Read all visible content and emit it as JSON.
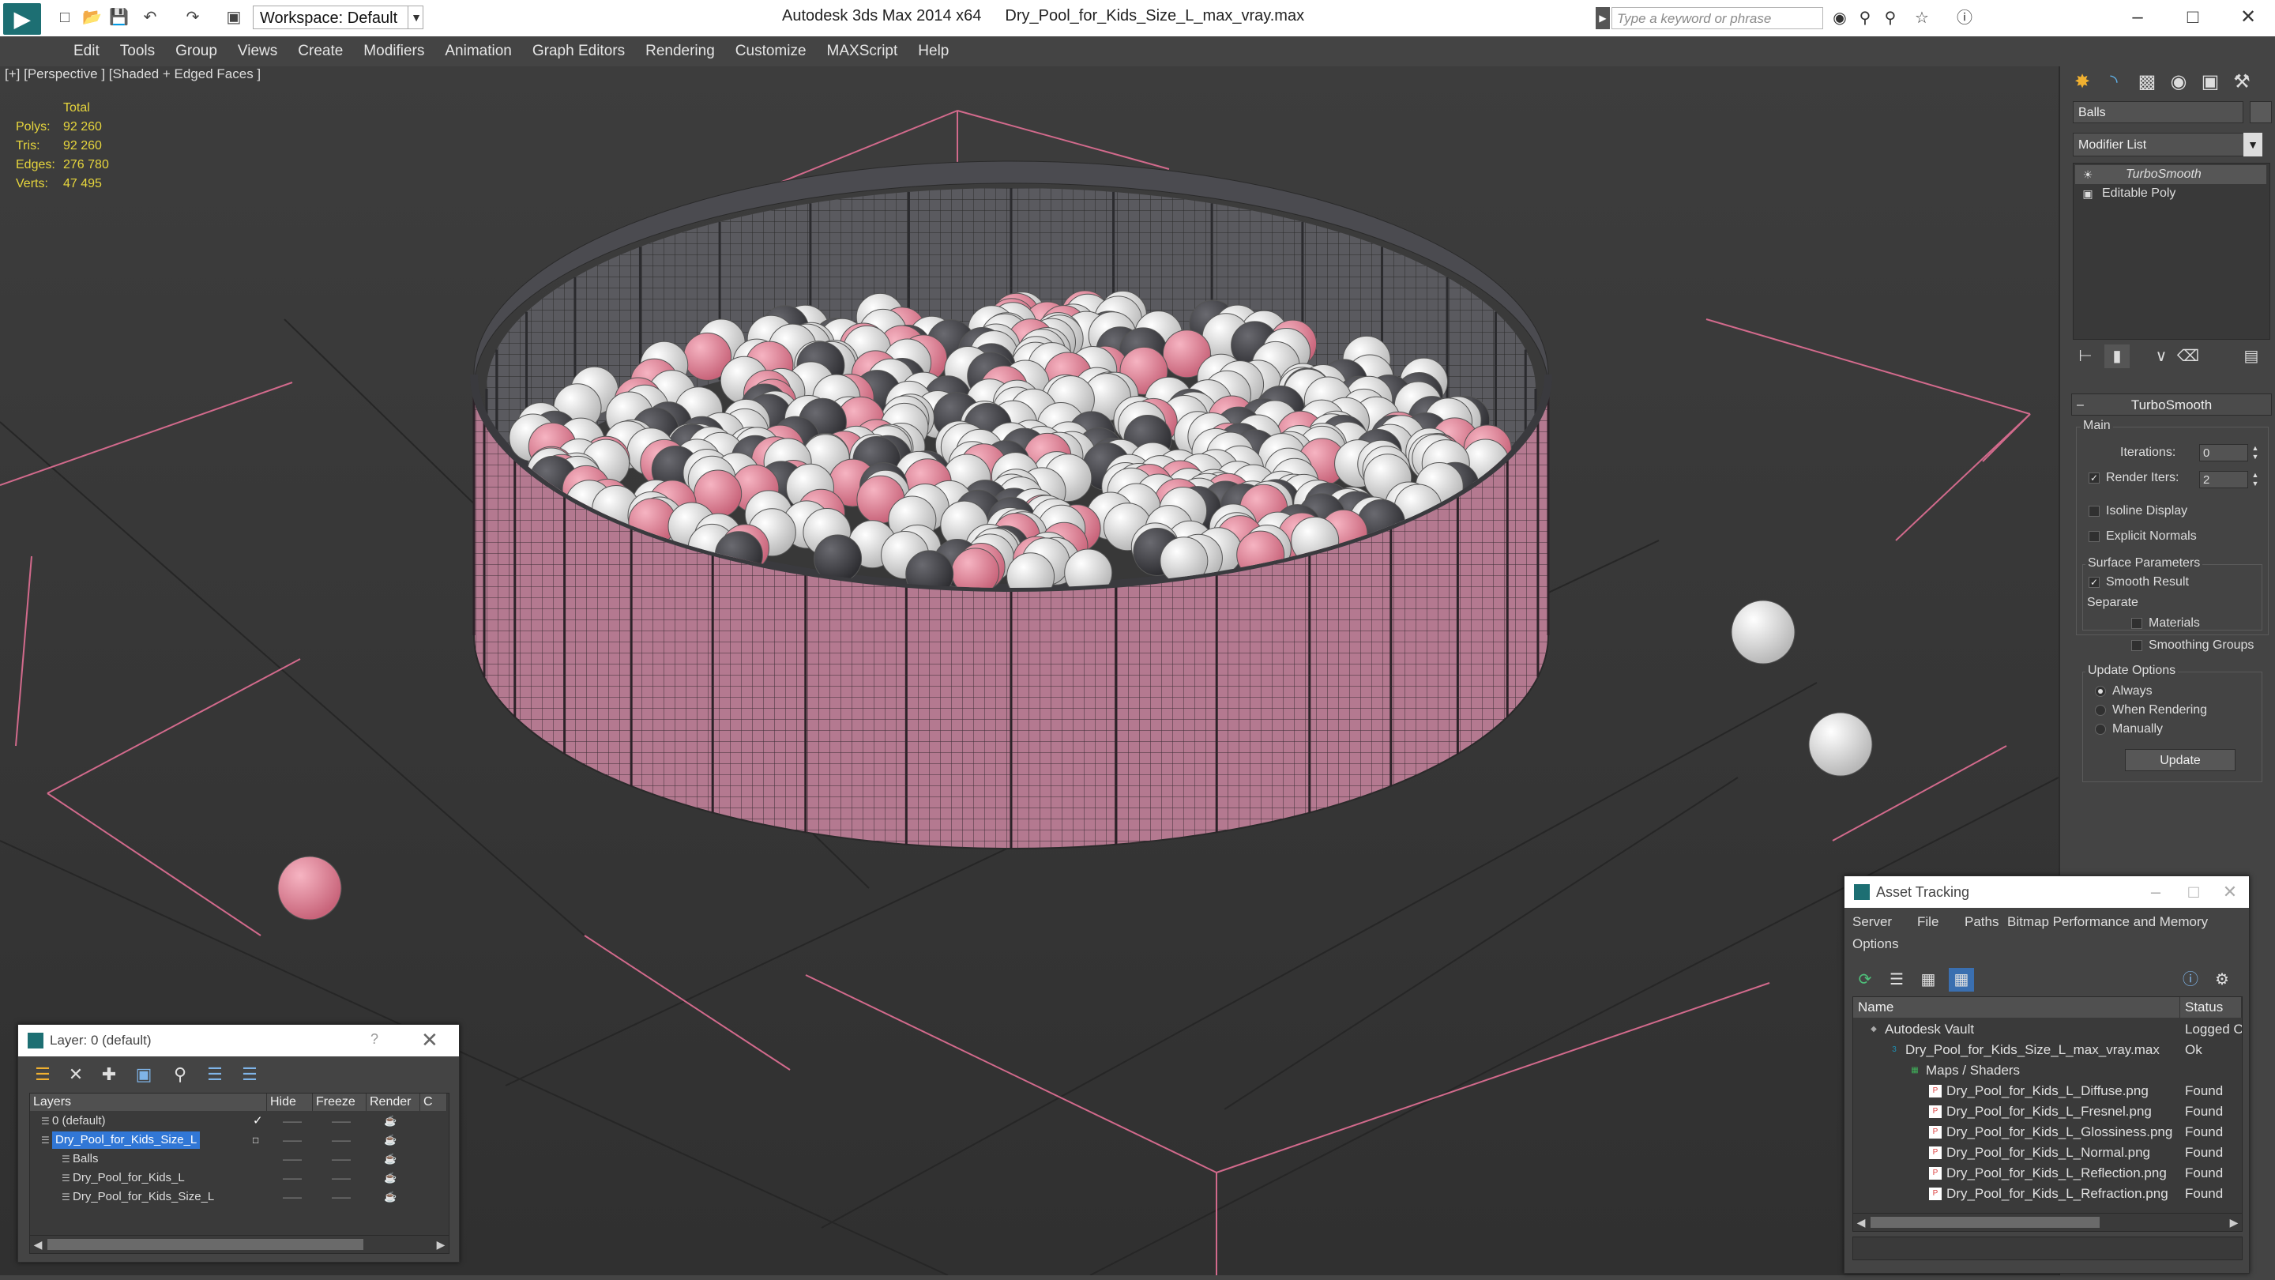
{
  "titlebar": {
    "workspace": "Workspace: Default",
    "app_name": "Autodesk 3ds Max  2014 x64",
    "file_name": "Dry_Pool_for_Kids_Size_L_max_vray.max",
    "search_placeholder": "Type a keyword or phrase"
  },
  "menu": [
    "Edit",
    "Tools",
    "Group",
    "Views",
    "Create",
    "Modifiers",
    "Animation",
    "Graph Editors",
    "Rendering",
    "Customize",
    "MAXScript",
    "Help"
  ],
  "viewport": {
    "label": "[+] [Perspective ] [Shaded + Edged Faces ]",
    "stats": {
      "header": "Total",
      "rows": [
        {
          "label": "Polys:",
          "value": "92 260"
        },
        {
          "label": "Tris:",
          "value": "92 260"
        },
        {
          "label": "Edges:",
          "value": "276 780"
        },
        {
          "label": "Verts:",
          "value": "47 495"
        }
      ]
    }
  },
  "command_panel": {
    "object_name": "Balls",
    "modifier_list": "Modifier List",
    "stack": [
      "TurboSmooth",
      "Editable Poly"
    ],
    "rollout_title": "TurboSmooth",
    "main_label": "Main",
    "iterations_label": "Iterations:",
    "iterations_value": "0",
    "render_iters_label": "Render Iters:",
    "render_iters_value": "2",
    "render_iters_checked": true,
    "isoline_label": "Isoline Display",
    "explicit_normals_label": "Explicit Normals",
    "surface_params_label": "Surface Parameters",
    "smooth_result_label": "Smooth Result",
    "smooth_result_checked": true,
    "separate_label": "Separate",
    "materials_label": "Materials",
    "smoothing_groups_label": "Smoothing Groups",
    "update_options_label": "Update Options",
    "radio_options": [
      "Always",
      "When Rendering",
      "Manually"
    ],
    "radio_selected": "Always",
    "update_button": "Update"
  },
  "layer_dialog": {
    "title": "Layer: 0 (default)",
    "help": "?",
    "columns": [
      "Layers",
      "Hide",
      "Freeze",
      "Render",
      "C"
    ],
    "rows": [
      {
        "name": "0 (default)",
        "indent": 1,
        "selected": false,
        "current": true
      },
      {
        "name": "Dry_Pool_for_Kids_Size_L",
        "indent": 1,
        "selected": true,
        "current": false
      },
      {
        "name": "Balls",
        "indent": 2,
        "selected": false,
        "current": false
      },
      {
        "name": "Dry_Pool_for_Kids_L",
        "indent": 2,
        "selected": false,
        "current": false
      },
      {
        "name": "Dry_Pool_for_Kids_Size_L",
        "indent": 2,
        "selected": false,
        "current": false
      }
    ]
  },
  "asset_dialog": {
    "title": "Asset Tracking",
    "menu": [
      "Server",
      "File",
      "Paths",
      "Bitmap Performance and Memory",
      "Options"
    ],
    "columns": [
      "Name",
      "Status"
    ],
    "rows": [
      {
        "name": "Autodesk Vault",
        "status": "Logged O",
        "level": 0,
        "icon": "vault"
      },
      {
        "name": "Dry_Pool_for_Kids_Size_L_max_vray.max",
        "status": "Ok",
        "level": 1,
        "icon": "max"
      },
      {
        "name": "Maps / Shaders",
        "status": "",
        "level": 2,
        "icon": "folder"
      },
      {
        "name": "Dry_Pool_for_Kids_L_Diffuse.png",
        "status": "Found",
        "level": 3,
        "icon": "png"
      },
      {
        "name": "Dry_Pool_for_Kids_L_Fresnel.png",
        "status": "Found",
        "level": 3,
        "icon": "png"
      },
      {
        "name": "Dry_Pool_for_Kids_L_Glossiness.png",
        "status": "Found",
        "level": 3,
        "icon": "png"
      },
      {
        "name": "Dry_Pool_for_Kids_L_Normal.png",
        "status": "Found",
        "level": 3,
        "icon": "png"
      },
      {
        "name": "Dry_Pool_for_Kids_L_Reflection.png",
        "status": "Found",
        "level": 3,
        "icon": "png"
      },
      {
        "name": "Dry_Pool_for_Kids_L_Refraction.png",
        "status": "Found",
        "level": 3,
        "icon": "png"
      }
    ]
  },
  "colors": {
    "pool_wall": "#b47990",
    "ball_white": "#e8e8e8",
    "ball_pink": "#e58a9e",
    "ball_dark": "#4a4a4e",
    "selection": "#3177d6",
    "stats_text": "#e7d63c",
    "gizmo_pink": "#d26a8c"
  }
}
